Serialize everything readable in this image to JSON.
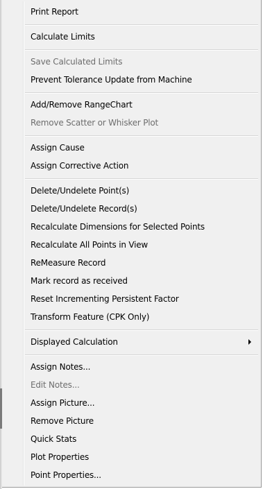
{
  "menu": {
    "items": [
      {
        "label": "Print Report",
        "disabled": false
      },
      {
        "label": "Calculate Limits",
        "disabled": false
      },
      {
        "label": "Save Calculated Limits",
        "disabled": true
      },
      {
        "label": "Prevent Tolerance Update from Machine",
        "disabled": false
      },
      {
        "label": "Add/Remove RangeChart",
        "disabled": false
      },
      {
        "label": "Remove Scatter or Whisker Plot",
        "disabled": true
      },
      {
        "label": "Assign Cause",
        "disabled": false
      },
      {
        "label": "Assign Corrective Action",
        "disabled": false
      },
      {
        "label": "Delete/Undelete Point(s)",
        "disabled": false
      },
      {
        "label": "Delete/Undelete Record(s)",
        "disabled": false
      },
      {
        "label": "Recalculate Dimensions for Selected Points",
        "disabled": false
      },
      {
        "label": "Recalculate All Points in View",
        "disabled": false
      },
      {
        "label": "ReMeasure Record",
        "disabled": false
      },
      {
        "label": "Mark record as received",
        "disabled": false
      },
      {
        "label": "Reset Incrementing Persistent Factor",
        "disabled": false
      },
      {
        "label": "Transform Feature (CPK Only)",
        "disabled": false
      },
      {
        "label": "Displayed Calculation",
        "disabled": false,
        "submenu": true
      },
      {
        "label": "Assign Notes...",
        "disabled": false
      },
      {
        "label": "Edit Notes...",
        "disabled": true
      },
      {
        "label": "Assign Picture...",
        "disabled": false
      },
      {
        "label": "Remove Picture",
        "disabled": false
      },
      {
        "label": "Quick Stats",
        "disabled": false
      },
      {
        "label": "Plot Properties",
        "disabled": false
      },
      {
        "label": "Point Properties...",
        "disabled": false
      }
    ]
  },
  "colors": {
    "menu_background": "#f0f0f0",
    "text": "#000000",
    "disabled_text": "#6d6d6d",
    "separator": "#d6d6d6",
    "border": "#979797"
  },
  "icons": {
    "submenu": "chevron-right-icon"
  }
}
